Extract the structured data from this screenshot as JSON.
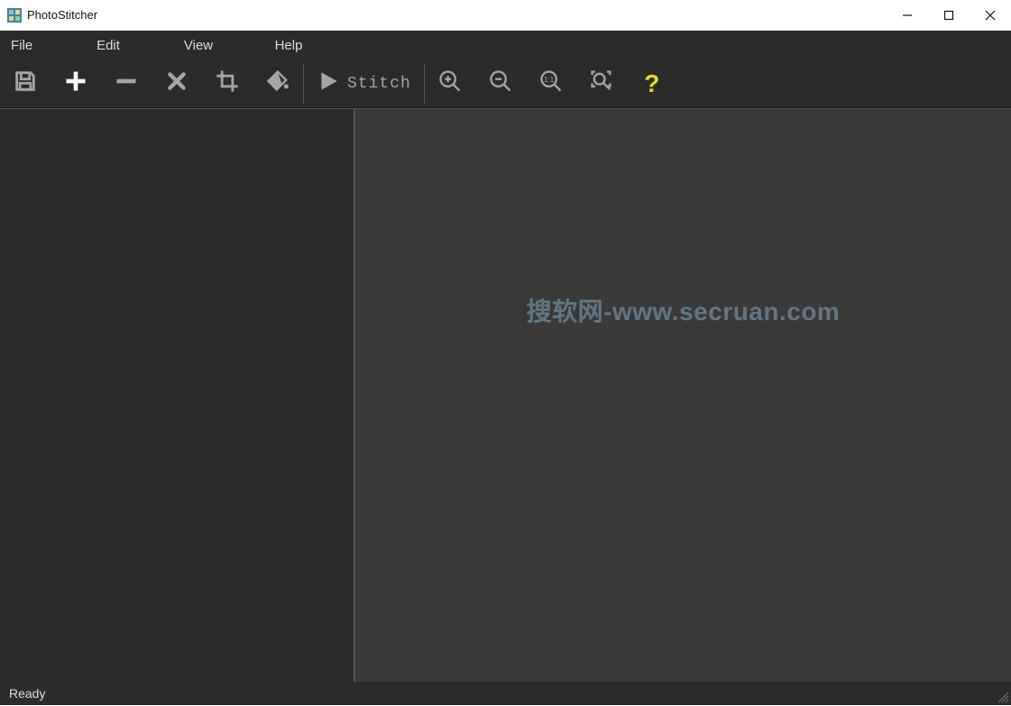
{
  "window": {
    "title": "PhotoStitcher"
  },
  "menu": {
    "items": [
      "File",
      "Edit",
      "View",
      "Help"
    ]
  },
  "toolbar": {
    "stitch_label": "Stitch"
  },
  "canvas": {
    "watermark": "搜软网-www.secruan.com"
  },
  "status": {
    "text": "Ready"
  }
}
